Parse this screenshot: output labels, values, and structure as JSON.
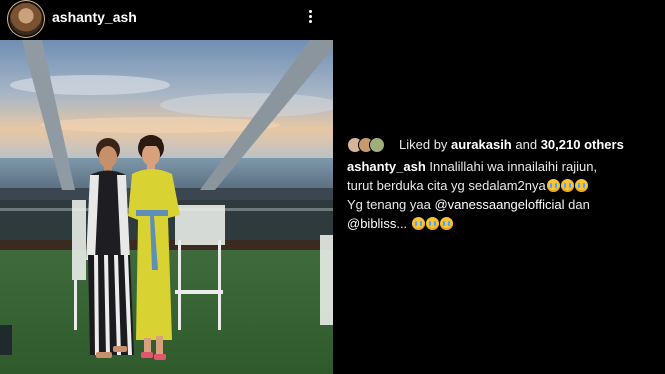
{
  "post": {
    "username": "ashanty_ash",
    "avatar_icon": "profile-avatar-icon",
    "more_icon": "more-options-icon"
  },
  "likes": {
    "prefix": "Liked by",
    "liker": "aurakasih",
    "conjunction": "and",
    "count": "30,210 others"
  },
  "caption": {
    "username": "ashanty_ash",
    "line1": "Innalillahi wa innailaihi rajiun,",
    "line2": "turut berduka cita yg sedalam2nya",
    "line3_text": "Yg tenang yaa ",
    "line3_mention": "@vanessaangelofficial",
    "line3_end": " dan",
    "line4_mention": "@bibliss",
    "line4_end": "...",
    "emoji": "crying-face-emoji"
  },
  "colors": {
    "background": "#000000",
    "text": "#ffffff"
  }
}
